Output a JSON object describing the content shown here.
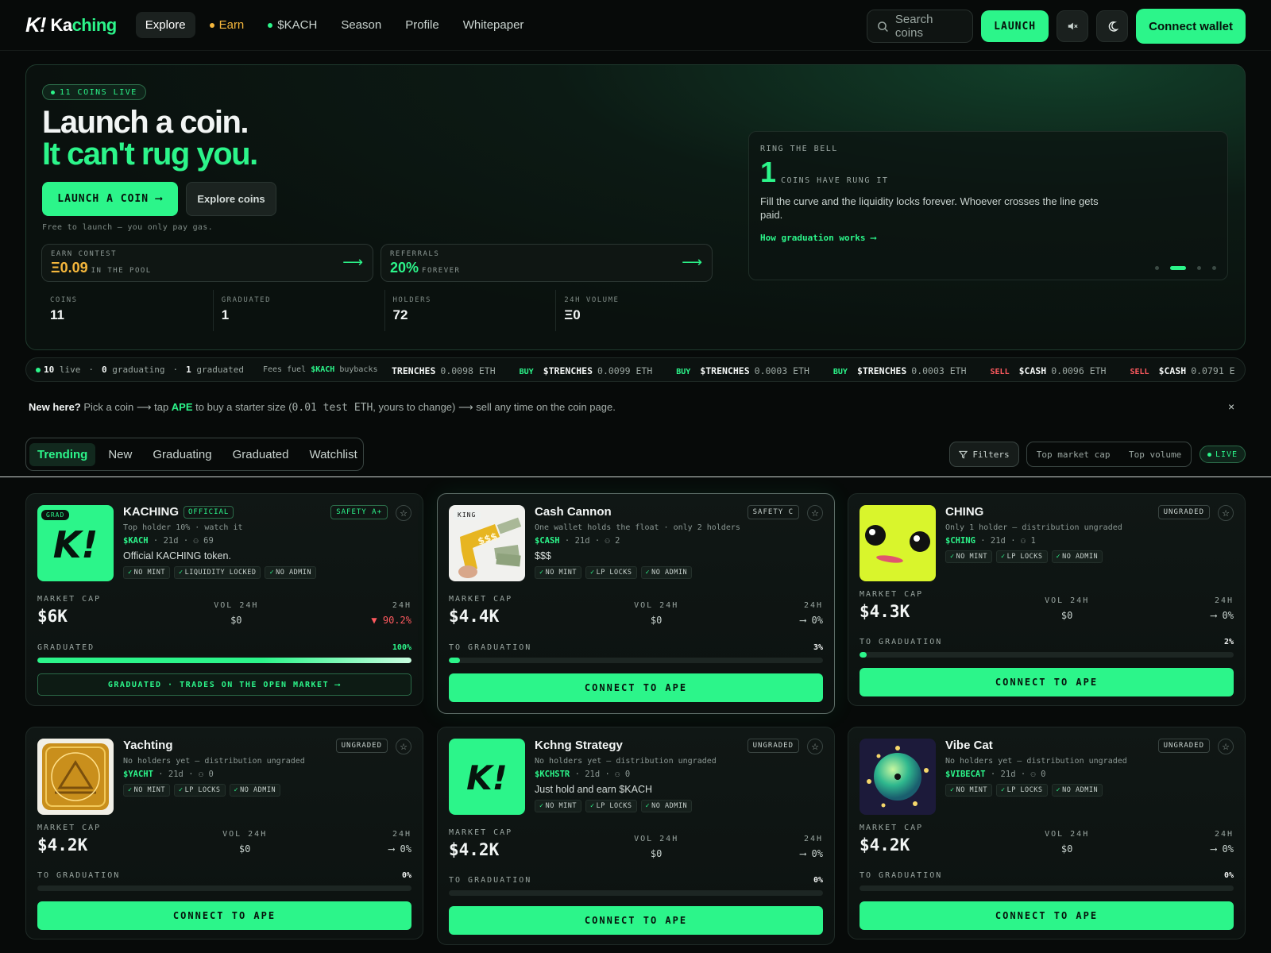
{
  "brand": {
    "mark": "K!",
    "name_prefix": "Ka",
    "name_suffix": "ching"
  },
  "nav": {
    "explore": "Explore",
    "earn": "Earn",
    "kach": "$KACH",
    "season": "Season",
    "profile": "Profile",
    "whitepaper": "Whitepaper"
  },
  "topbar": {
    "search_placeholder": "Search coins",
    "launch": "LAUNCH",
    "wallet": "Connect wallet"
  },
  "hero": {
    "live_pill": "11 COINS LIVE",
    "headline": "Launch a coin.",
    "headline_accent": "It can't rug you.",
    "cta_primary": "LAUNCH A COIN ⟶",
    "cta_secondary": "Explore coins",
    "note": "Free to launch — you only pay gas.",
    "earn_card": {
      "label": "EARN CONTEST",
      "value": "Ξ0.09",
      "suffix": "IN THE POOL"
    },
    "ref_card": {
      "label": "REFERRALS",
      "value": "20%",
      "suffix": "FOREVER"
    },
    "stats": [
      {
        "label": "COINS",
        "value": "11"
      },
      {
        "label": "GRADUATED",
        "value": "1"
      },
      {
        "label": "HOLDERS",
        "value": "72"
      },
      {
        "label": "24H VOLUME",
        "value": "Ξ0"
      }
    ],
    "bell": {
      "label": "RING THE BELL",
      "count": "1",
      "count_label": "COINS HAVE RUNG IT",
      "body": "Fill the curve and the liquidity locks forever. Whoever crosses the line gets paid.",
      "link": "How graduation works ⟶",
      "slides": 4,
      "active_slide": 1
    }
  },
  "ticker": {
    "live_count": "10",
    "live_label": "live",
    "graduating_count": "0",
    "graduating_label": "graduating",
    "graduated_count": "1",
    "graduated_label": "graduated",
    "fees_prefix": "Fees fuel",
    "fees_token": "$KACH",
    "fees_suffix": "buybacks",
    "trades": [
      {
        "side": "",
        "symbol": "TRENCHES",
        "amount": "0.0098 ETH"
      },
      {
        "side": "BUY",
        "symbol": "$TRENCHES",
        "amount": "0.0099 ETH"
      },
      {
        "side": "BUY",
        "symbol": "$TRENCHES",
        "amount": "0.0003 ETH"
      },
      {
        "side": "BUY",
        "symbol": "$TRENCHES",
        "amount": "0.0003 ETH"
      },
      {
        "side": "SELL",
        "symbol": "$CASH",
        "amount": "0.0096 ETH"
      },
      {
        "side": "SELL",
        "symbol": "$CASH",
        "amount": "0.0791 E"
      }
    ]
  },
  "onboarding": {
    "lead": "New here?",
    "text1": "Pick a coin ⟶ tap",
    "ape": "APE",
    "text2": "to buy a starter size (",
    "amount": "0.01 test ETH",
    "text3": ", yours to change) ⟶ sell any time on the coin page.",
    "close": "×"
  },
  "tabs": [
    "Trending",
    "New",
    "Graduating",
    "Graduated",
    "Watchlist"
  ],
  "filters": {
    "filters": "Filters",
    "sort1": "Top market cap",
    "sort2": "Top volume",
    "live": "LIVE"
  },
  "labels": {
    "market_cap": "MARKET CAP",
    "vol_24h": "VOL 24H",
    "change_24h": "24H",
    "to_graduation": "TO GRADUATION",
    "graduated": "GRADUATED",
    "connect": "CONNECT TO APE",
    "graduated_cta": "GRADUATED · TRADES ON THE OPEN MARKET ⟶"
  },
  "coins": [
    {
      "name": "KACHING",
      "badge": "OFFICIAL",
      "safety": "SAFETY A+",
      "tag": "GRAD",
      "warning": "Top holder 10% · watch it",
      "ticker": "$KACH",
      "age": "21d",
      "holders": "69",
      "desc": "Official KACHING token.",
      "chips": [
        "NO MINT",
        "LIQUIDITY LOCKED",
        "NO ADMIN"
      ],
      "market_cap": "$6K",
      "vol": "$0",
      "change": "▼ 90.2%",
      "progress": "100%",
      "progress_value": 100
    },
    {
      "name": "Cash Cannon",
      "badge": "",
      "safety": "SAFETY C",
      "tag": "KING",
      "warning": "One wallet holds the float · only 2 holders",
      "ticker": "$CASH",
      "age": "21d",
      "holders": "2",
      "desc": "$$$",
      "chips": [
        "NO MINT",
        "LP LOCKS",
        "NO ADMIN"
      ],
      "market_cap": "$4.4K",
      "vol": "$0",
      "change": "⟶ 0%",
      "progress": "3%",
      "progress_value": 3
    },
    {
      "name": "CHING",
      "badge": "",
      "safety": "UNGRADED",
      "tag": "",
      "warning": "Only 1 holder — distribution ungraded",
      "ticker": "$CHING",
      "age": "21d",
      "holders": "1",
      "desc": "",
      "chips": [
        "NO MINT",
        "LP LOCKS",
        "NO ADMIN"
      ],
      "market_cap": "$4.3K",
      "vol": "$0",
      "change": "⟶ 0%",
      "progress": "2%",
      "progress_value": 2
    },
    {
      "name": "Yachting",
      "badge": "",
      "safety": "UNGRADED",
      "tag": "",
      "warning": "No holders yet — distribution ungraded",
      "ticker": "$YACHT",
      "age": "21d",
      "holders": "0",
      "desc": "",
      "chips": [
        "NO MINT",
        "LP LOCKS",
        "NO ADMIN"
      ],
      "market_cap": "$4.2K",
      "vol": "$0",
      "change": "⟶ 0%",
      "progress": "0%",
      "progress_value": 0
    },
    {
      "name": "Kchng Strategy",
      "badge": "",
      "safety": "UNGRADED",
      "tag": "",
      "warning": "No holders yet — distribution ungraded",
      "ticker": "$KCHSTR",
      "age": "21d",
      "holders": "0",
      "desc": "Just hold and earn $KACH",
      "chips": [
        "NO MINT",
        "LP LOCKS",
        "NO ADMIN"
      ],
      "market_cap": "$4.2K",
      "vol": "$0",
      "change": "⟶ 0%",
      "progress": "0%",
      "progress_value": 0
    },
    {
      "name": "Vibe Cat",
      "badge": "",
      "safety": "UNGRADED",
      "tag": "",
      "warning": "No holders yet — distribution ungraded",
      "ticker": "$VIBECAT",
      "age": "21d",
      "holders": "0",
      "desc": "",
      "chips": [
        "NO MINT",
        "LP LOCKS",
        "NO ADMIN"
      ],
      "market_cap": "$4.2K",
      "vol": "$0",
      "change": "⟶ 0%",
      "progress": "0%",
      "progress_value": 0
    }
  ],
  "colors": {
    "accent": "#2cf58a",
    "earn": "#f5b73c",
    "sell": "#ff5a5f",
    "background": "#070a09"
  }
}
